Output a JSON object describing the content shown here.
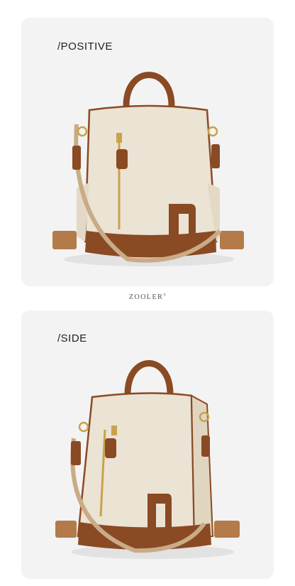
{
  "panels": [
    {
      "label": "/POSITIVE"
    },
    {
      "label": "/SIDE"
    }
  ],
  "brand": {
    "name": "ZOOLER",
    "mark": "®"
  },
  "colors": {
    "background": "#f3f3f3",
    "canvas": "#c9ab86",
    "leather": "#8a4a24",
    "hardware": "#c9a24c"
  }
}
